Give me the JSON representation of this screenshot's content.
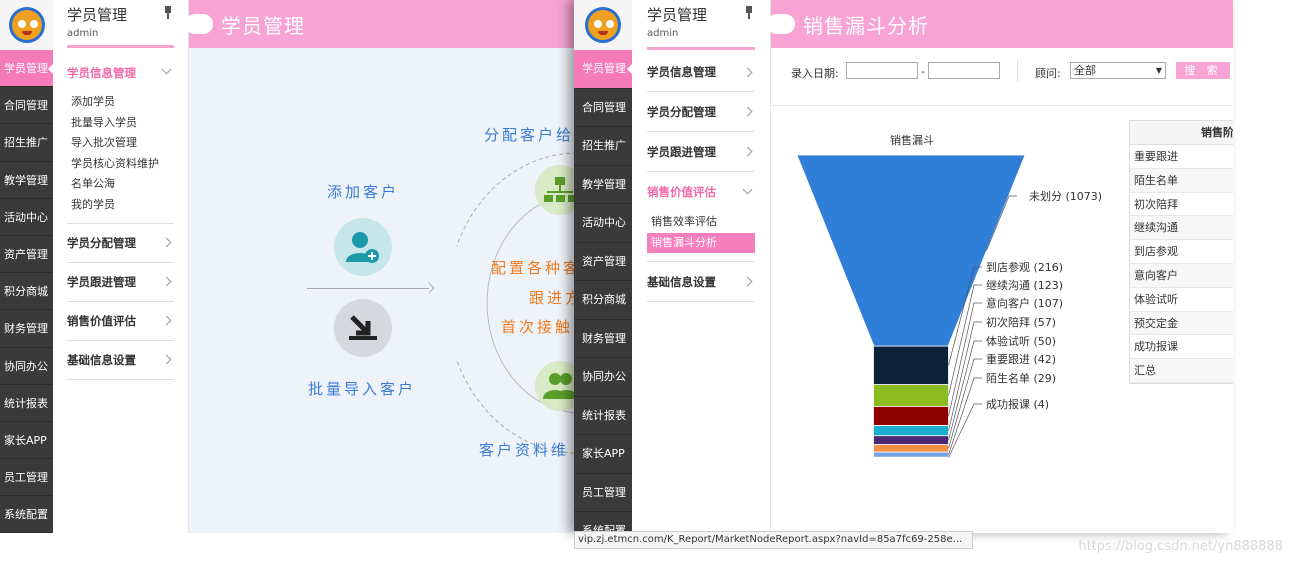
{
  "window1": {
    "nav": [
      "学员管理",
      "合同管理",
      "招生推广",
      "教学管理",
      "活动中心",
      "资产管理",
      "积分商城",
      "财务管理",
      "协同办公",
      "统计报表",
      "家长APP",
      "员工管理",
      "系统配置"
    ],
    "sidebar": {
      "title": "学员管理",
      "user": "admin",
      "groups": [
        {
          "label": "学员信息管理",
          "items": [
            "添加学员",
            "批量导入学员",
            "导入批次管理",
            "学员核心资料维护",
            "名单公海",
            "我的学员"
          ]
        },
        {
          "label": "学员分配管理"
        },
        {
          "label": "学员跟进管理"
        },
        {
          "label": "销售价值评估"
        },
        {
          "label": "基础信息设置"
        }
      ]
    },
    "header_title": "学员管理",
    "diagram": {
      "add_customer": "添加客户",
      "batch_import": "批量导入客户",
      "assign": "分配客户给",
      "config": "配置各种客",
      "follow": "跟进方",
      "first_contact": "首次接触",
      "maintain": "客户资料维"
    }
  },
  "window2": {
    "nav": [
      "学员管理",
      "合同管理",
      "招生推广",
      "教学管理",
      "活动中心",
      "资产管理",
      "积分商城",
      "财务管理",
      "协同办公",
      "统计报表",
      "家长APP",
      "员工管理",
      "系统配置"
    ],
    "sidebar": {
      "title": "学员管理",
      "user": "admin",
      "groups": [
        {
          "label": "学员信息管理"
        },
        {
          "label": "学员分配管理"
        },
        {
          "label": "学员跟进管理"
        },
        {
          "label": "销售价值评估",
          "items": [
            "销售效率评估",
            "销售漏斗分析"
          ]
        },
        {
          "label": "基础信息设置"
        }
      ]
    },
    "header_title": "销售漏斗分析",
    "filter": {
      "date_label": "录入日期:",
      "dash": "-",
      "advisor_label": "顾问:",
      "advisor_value": "全部",
      "search_button": "搜 索"
    },
    "legend": {
      "header": "销售阶",
      "rows": [
        "重要跟进",
        "陌生名单",
        "初次陪拜",
        "继续沟通",
        "到店参观",
        "意向客户",
        "体验试听",
        "预交定金",
        "成功报课",
        "汇总"
      ]
    }
  },
  "chart_data": {
    "type": "funnel",
    "title": "销售漏斗",
    "categories": [
      "未划分",
      "到店参观",
      "继续沟通",
      "意向客户",
      "初次陪拜",
      "体验试听",
      "重要跟进",
      "陌生名单",
      "成功报课"
    ],
    "values": [
      1073,
      216,
      123,
      107,
      57,
      50,
      42,
      29,
      4
    ],
    "labels": [
      "未划分 (1073)",
      "到店参观 (216)",
      "继续沟通 (123)",
      "意向客户 (107)",
      "初次陪拜 (57)",
      "体验试听 (50)",
      "重要跟进 (42)",
      "陌生名单 (29)",
      "成功报课 (4)"
    ],
    "colors": [
      "#2f7ed8",
      "#0d233a",
      "#8bbc21",
      "#910000",
      "#1aadce",
      "#492970",
      "#f28f43",
      "#77a1e5",
      "#c42525"
    ]
  },
  "status_url": "vip.zj.etmcn.com/K_Report/MarketNodeReport.aspx?navId=85a7fc69-258e...",
  "watermark": "https://blog.csdn.net/yn888888"
}
